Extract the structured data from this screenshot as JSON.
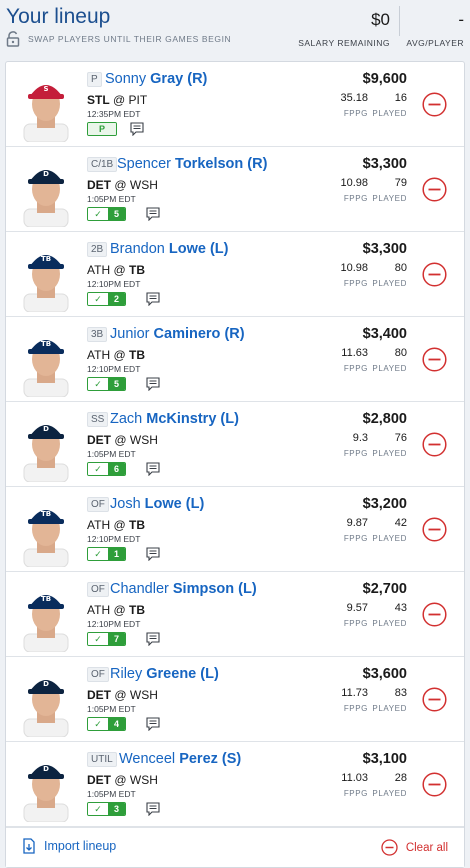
{
  "header": {
    "title": "Your lineup",
    "swap_note": "SWAP PLAYERS UNTIL THEIR GAMES BEGIN",
    "salary_value": "$0",
    "salary_label": "SALARY REMAINING",
    "avg_value": "-",
    "avg_label": "AVG/PLAYER"
  },
  "labels": {
    "fppg": "FPPG",
    "played": "PLAYED"
  },
  "colors": {
    "accent": "#1765c1",
    "remove": "#d23030",
    "badge": "#2e9e3a"
  },
  "players": [
    {
      "pos": "P",
      "first": "Sonny",
      "last": "Gray",
      "hand": "(R)",
      "team": "STL",
      "at": "@",
      "opp": "PIT",
      "team_bold": true,
      "time": "12:35PM EDT",
      "badge": "P",
      "badge_type": "pitcher",
      "price": "$9,600",
      "fppg": "35.18",
      "played": "16",
      "cap": "STL",
      "cap_color": "#c41e3a"
    },
    {
      "pos": "C/1B",
      "first": "Spencer",
      "last": "Torkelson",
      "hand": "(R)",
      "team": "DET",
      "at": "@",
      "opp": "WSH",
      "team_bold": true,
      "time": "1:05PM EDT",
      "badge": "5",
      "badge_type": "order",
      "price": "$3,300",
      "fppg": "10.98",
      "played": "79",
      "cap": "DET",
      "cap_color": "#0c2340"
    },
    {
      "pos": "2B",
      "first": "Brandon",
      "last": "Lowe",
      "hand": "(L)",
      "team": "ATH",
      "at": "@",
      "opp": "TB",
      "team_bold": false,
      "time": "12:10PM EDT",
      "badge": "2",
      "badge_type": "order",
      "price": "$3,300",
      "fppg": "10.98",
      "played": "80",
      "cap": "TB",
      "cap_color": "#092c5c"
    },
    {
      "pos": "3B",
      "first": "Junior",
      "last": "Caminero",
      "hand": "(R)",
      "team": "ATH",
      "at": "@",
      "opp": "TB",
      "team_bold": false,
      "time": "12:10PM EDT",
      "badge": "5",
      "badge_type": "order",
      "price": "$3,400",
      "fppg": "11.63",
      "played": "80",
      "cap": "TB",
      "cap_color": "#092c5c"
    },
    {
      "pos": "SS",
      "first": "Zach",
      "last": "McKinstry",
      "hand": "(L)",
      "team": "DET",
      "at": "@",
      "opp": "WSH",
      "team_bold": true,
      "time": "1:05PM EDT",
      "badge": "6",
      "badge_type": "order",
      "price": "$2,800",
      "fppg": "9.3",
      "played": "76",
      "cap": "DET",
      "cap_color": "#0c2340"
    },
    {
      "pos": "OF",
      "first": "Josh",
      "last": "Lowe",
      "hand": "(L)",
      "team": "ATH",
      "at": "@",
      "opp": "TB",
      "team_bold": false,
      "time": "12:10PM EDT",
      "badge": "1",
      "badge_type": "order",
      "price": "$3,200",
      "fppg": "9.87",
      "played": "42",
      "cap": "TB",
      "cap_color": "#092c5c"
    },
    {
      "pos": "OF",
      "first": "Chandler",
      "last": "Simpson",
      "hand": "(L)",
      "team": "ATH",
      "at": "@",
      "opp": "TB",
      "team_bold": false,
      "time": "12:10PM EDT",
      "badge": "7",
      "badge_type": "order",
      "price": "$2,700",
      "fppg": "9.57",
      "played": "43",
      "cap": "TB",
      "cap_color": "#092c5c"
    },
    {
      "pos": "OF",
      "first": "Riley",
      "last": "Greene",
      "hand": "(L)",
      "team": "DET",
      "at": "@",
      "opp": "WSH",
      "team_bold": true,
      "time": "1:05PM EDT",
      "badge": "4",
      "badge_type": "order",
      "price": "$3,600",
      "fppg": "11.73",
      "played": "83",
      "cap": "DET",
      "cap_color": "#0c2340"
    },
    {
      "pos": "UTIL",
      "first": "Wenceel",
      "last": "Perez",
      "hand": "(S)",
      "team": "DET",
      "at": "@",
      "opp": "WSH",
      "team_bold": true,
      "time": "1:05PM EDT",
      "badge": "3",
      "badge_type": "order",
      "price": "$3,100",
      "fppg": "11.03",
      "played": "28",
      "cap": "DET",
      "cap_color": "#0c2340"
    }
  ],
  "footer": {
    "import_label": "Import lineup",
    "clear_label": "Clear all"
  }
}
